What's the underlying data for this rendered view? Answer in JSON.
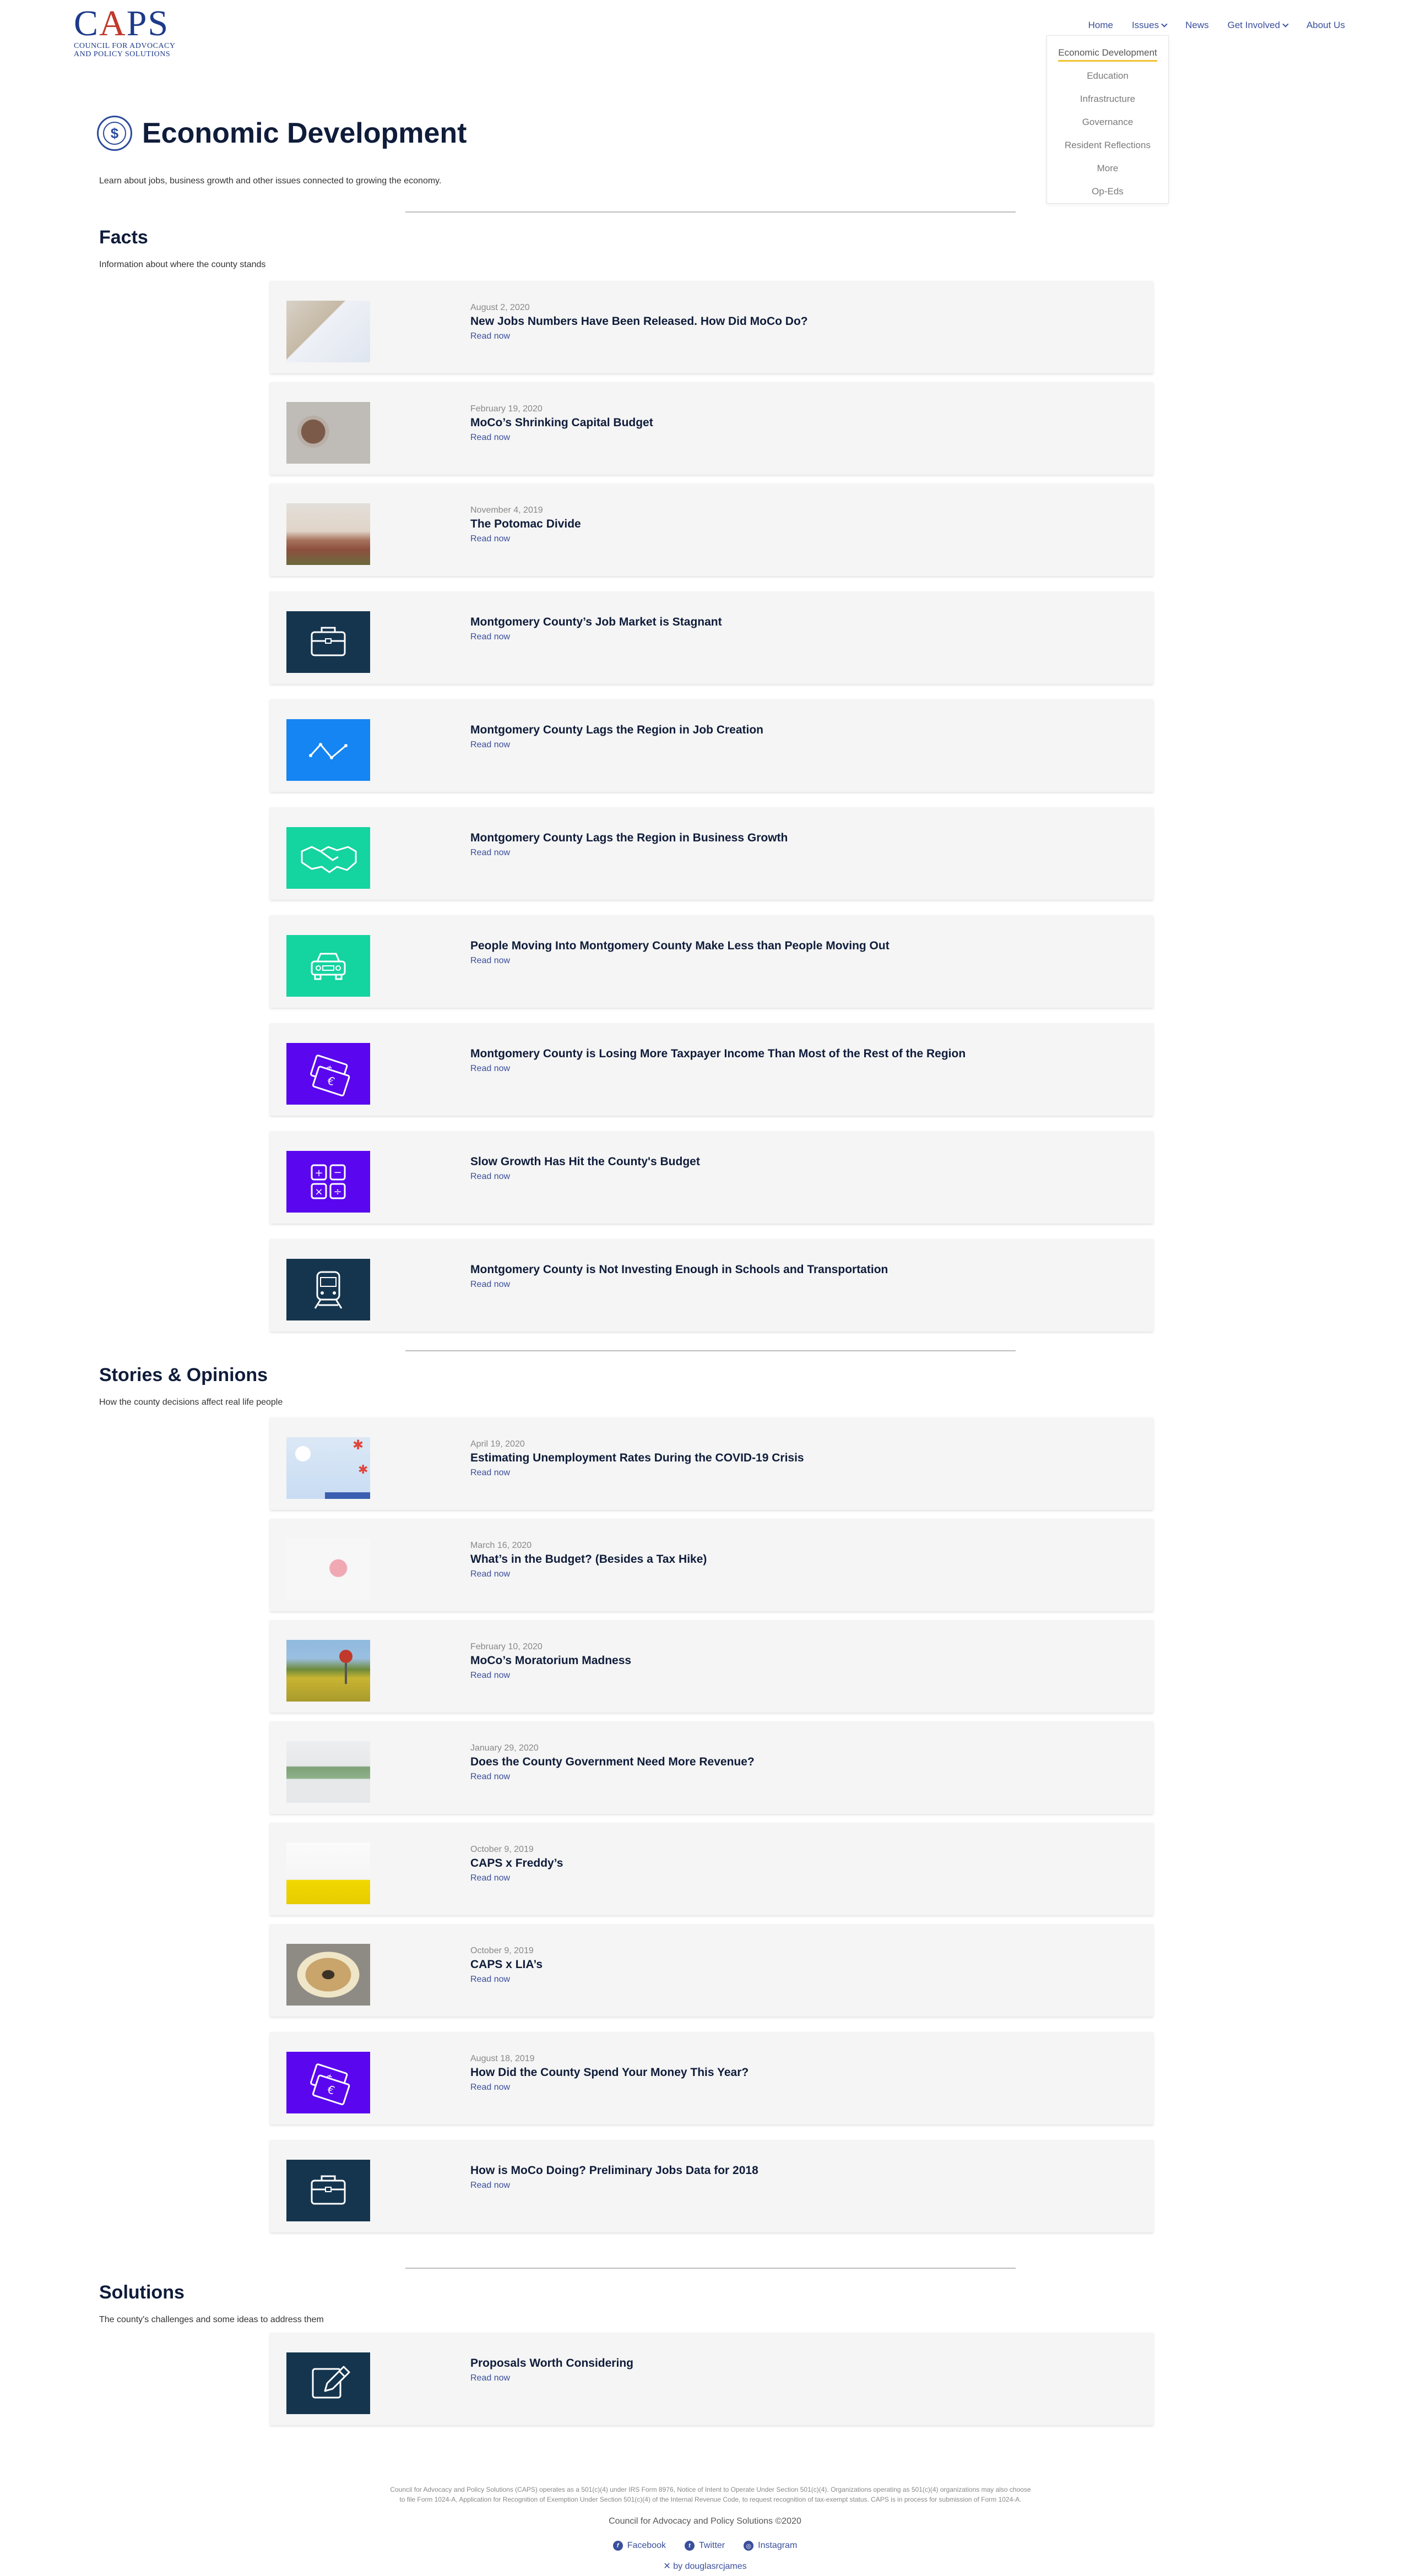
{
  "logo": {
    "mark": "CAPS",
    "subtitle_line1": "COUNCIL FOR ADVOCACY",
    "subtitle_line2": "AND POLICY SOLUTIONS"
  },
  "nav": {
    "home": "Home",
    "issues": "Issues",
    "news": "News",
    "get_involved": "Get Involved",
    "about": "About Us"
  },
  "dropdown": [
    "Economic Development",
    "Education",
    "Infrastructure",
    "Governance",
    "Resident Reflections",
    "More",
    "Op-Eds"
  ],
  "page": {
    "icon": "dollar-circle-icon",
    "title": "Economic Development",
    "description": "Learn about jobs, business growth and other issues connected to growing the economy."
  },
  "facts": {
    "title": "Facts",
    "description": "Information about where the county stands",
    "items": [
      {
        "date": "August 2, 2020",
        "title": "New Jobs Numbers Have Been Released. How Did MoCo Do?",
        "read": "Read now"
      },
      {
        "date": "February 19, 2020",
        "title": "MoCo’s Shrinking Capital Budget",
        "read": "Read now"
      },
      {
        "date": "November 4, 2019",
        "title": "The Potomac Divide",
        "read": "Read now"
      },
      {
        "title": "Montgomery County’s Job Market is Stagnant",
        "read": "Read now",
        "icon": "briefcase-icon"
      },
      {
        "title": "Montgomery County Lags the Region in Job Creation",
        "read": "Read now",
        "icon": "line-chart-icon"
      },
      {
        "title": "Montgomery County Lags the Region in Business Growth",
        "read": "Read now",
        "icon": "handshake-icon"
      },
      {
        "title": "People Moving Into Montgomery County Make Less than People Moving Out",
        "read": "Read now",
        "icon": "car-icon"
      },
      {
        "title": "Montgomery County is Losing More Taxpayer Income Than Most of the Rest of the Region",
        "read": "Read now",
        "icon": "money-icon"
      },
      {
        "title": "Slow Growth Has Hit the County's Budget",
        "read": "Read now",
        "icon": "calculator-icon"
      },
      {
        "title": "Montgomery County is Not Investing Enough in Schools and Transportation",
        "read": "Read now",
        "icon": "train-icon"
      }
    ]
  },
  "stories": {
    "title": "Stories & Opinions",
    "description": "How the county decisions affect real life people",
    "items": [
      {
        "date": "April 19, 2020",
        "title": "Estimating Unemployment Rates During the COVID-19 Crisis",
        "read": "Read now"
      },
      {
        "date": "March 16, 2020",
        "title": "What’s in the Budget? (Besides a Tax Hike)",
        "read": "Read now"
      },
      {
        "date": "February 10, 2020",
        "title": "MoCo’s Moratorium Madness",
        "read": "Read now"
      },
      {
        "date": "January 29, 2020",
        "title": "Does the County Government Need More Revenue?",
        "read": "Read now"
      },
      {
        "date": "October 9, 2019",
        "title": "CAPS x Freddy’s",
        "read": "Read now"
      },
      {
        "date": "October 9, 2019",
        "title": "CAPS x LIA’s",
        "read": "Read now"
      },
      {
        "date": "August 18, 2019",
        "title": "How Did the County Spend Your Money This Year?",
        "read": "Read now",
        "icon": "money-icon"
      },
      {
        "title": "How is MoCo Doing? Preliminary Jobs Data for 2018",
        "read": "Read now",
        "icon": "briefcase-icon"
      }
    ]
  },
  "solutions": {
    "title": "Solutions",
    "description": "The county's challenges and some ideas to address them",
    "items": [
      {
        "title": "Proposals Worth Considering",
        "read": "Read now",
        "icon": "edit-icon"
      }
    ]
  },
  "footer": {
    "legal_1": "Council for Advocacy and Policy Solutions (CAPS) operates as a 501(c)(4) under IRS Form 8976, Notice of Intent to Operate Under Section 501(c)(4). Organizations operating as 501(c)(4) organizations may also choose",
    "legal_2": "to file Form 1024-A, Application for Recognition of Exemption Under Section 501(c)(4) of the Internal Revenue Code, to request recognition of tax-exempt status. CAPS is in process for submission of Form 1024-A.",
    "copyright": "Council for Advocacy and Policy Solutions  ©2020",
    "facebook": "Facebook",
    "twitter": "Twitter",
    "instagram": "Instagram",
    "credit": "by douglasrcjames"
  }
}
